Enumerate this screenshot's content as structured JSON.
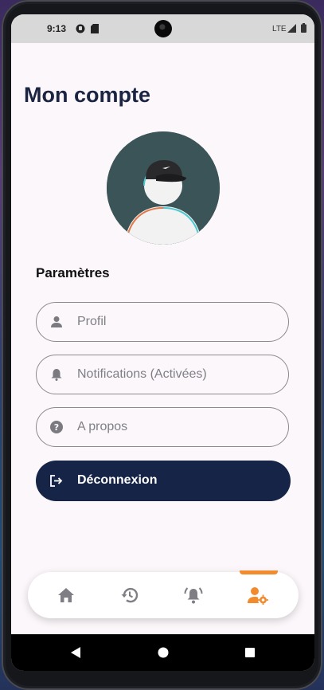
{
  "status_bar": {
    "time": "9:13",
    "network": "LTE",
    "icons": [
      "app-notification-icon",
      "sd-card-icon",
      "signal-icon",
      "battery-icon"
    ]
  },
  "page": {
    "title": "Mon compte",
    "section_title": "Paramètres"
  },
  "menu": [
    {
      "label": "Profil",
      "icon": "person-icon"
    },
    {
      "label": "Notifications (Activées)",
      "icon": "bell-icon"
    },
    {
      "label": "A propos",
      "icon": "help-circle-icon"
    }
  ],
  "logout": {
    "label": "Déconnexion",
    "icon": "logout-icon"
  },
  "bottom_nav": {
    "items": [
      "home-icon",
      "history-icon",
      "notification-alert-icon",
      "account-settings-icon"
    ],
    "active_index": 3
  },
  "colors": {
    "primary_dark": "#162447",
    "accent": "#f28a2e",
    "background": "#fcf7fa",
    "muted_text": "#7f7f86"
  }
}
